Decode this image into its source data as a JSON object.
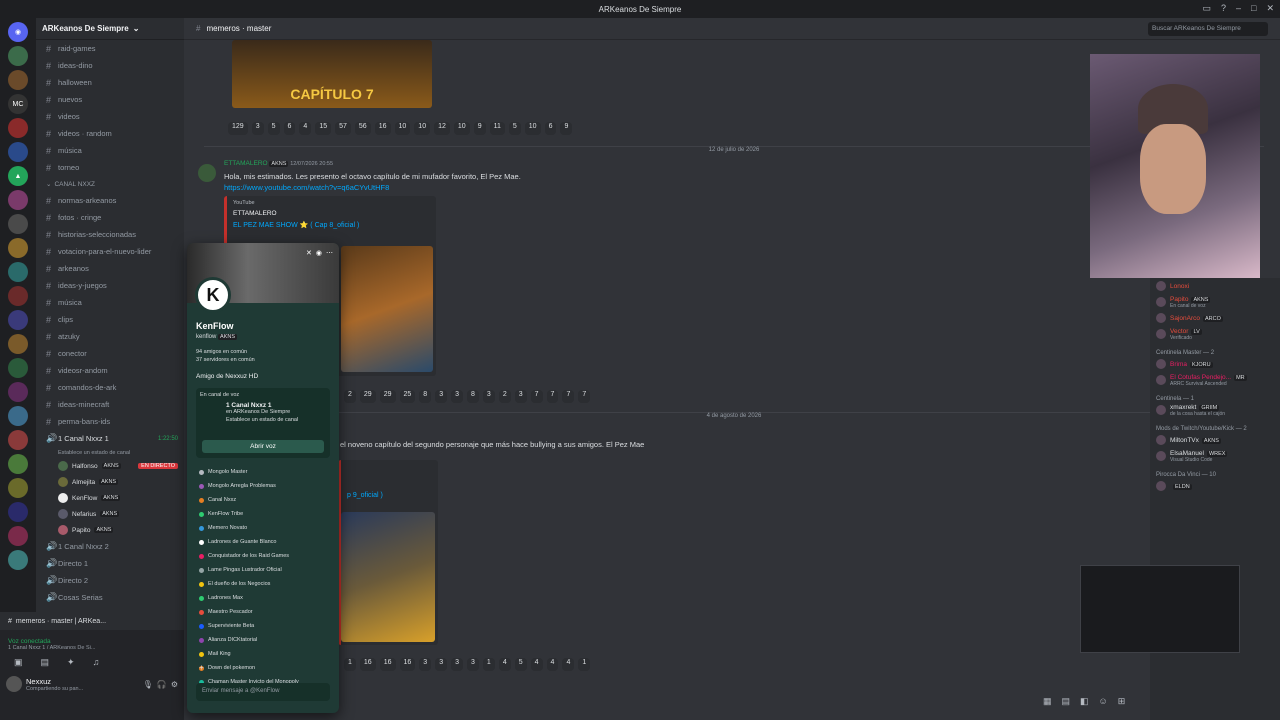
{
  "window": {
    "title": "ARKeanos De Siempre"
  },
  "server": {
    "name": "ARKeanos De Siempre"
  },
  "channels": [
    {
      "name": "raid-games"
    },
    {
      "name": "ideas-dino"
    },
    {
      "name": "halloween"
    },
    {
      "name": "nuevos"
    },
    {
      "name": "videos"
    },
    {
      "name": "videos · random"
    },
    {
      "name": "música"
    },
    {
      "name": "torneo"
    }
  ],
  "category1": "CANAL NXXZ",
  "channels2": [
    {
      "name": "normas-arkeanos"
    },
    {
      "name": "fotos · cringe"
    },
    {
      "name": "historias-seleccionadas"
    },
    {
      "name": "votacion-para-el-nuevo-lider"
    },
    {
      "name": "arkeanos"
    },
    {
      "name": "ideas-y-juegos"
    },
    {
      "name": "música"
    },
    {
      "name": "clips"
    },
    {
      "name": "atzuky"
    },
    {
      "name": "conector"
    },
    {
      "name": "videosr-andom"
    },
    {
      "name": "comandos-de-ark"
    },
    {
      "name": "ideas-minecraft"
    },
    {
      "name": "perma-bans-ids"
    }
  ],
  "voice_channel": {
    "name": "1 Canal Nxxz 1",
    "timer": "1:22:50",
    "status": "Establece un estado de canal"
  },
  "voice_users": [
    {
      "name": "Halfonso",
      "tag": "AKNS",
      "live": "EN DIRECTO"
    },
    {
      "name": "Almejita",
      "tag": "AKNS"
    },
    {
      "name": "KenFlow",
      "tag": "AKNS"
    },
    {
      "name": "Nefarius",
      "tag": "AKNS"
    },
    {
      "name": "Papito",
      "tag": "AKNS"
    }
  ],
  "voice_channels2": [
    {
      "name": "1 Canal Nxxz 2"
    },
    {
      "name": "Directo 1"
    },
    {
      "name": "Directo 2"
    },
    {
      "name": "Cosas Serias"
    }
  ],
  "userpanel": {
    "active_channel": "memeros · master | ARKea...",
    "voice_status": "Voz conectada",
    "voice_sub": "1 Canal Nxxz 1 / ARKeanos De Si...",
    "username": "Nexxuz",
    "user_status": "Compartiendo su pan..."
  },
  "topbar": {
    "channel": "memeros · master",
    "search_placeholder": "Buscar ARKeanos De Siempre"
  },
  "reactions_top": [
    "129",
    "3",
    "5",
    "6",
    "4",
    "15",
    "57",
    "56",
    "16",
    "10",
    "10",
    "12",
    "10",
    "9",
    "11",
    "5",
    "10",
    "6",
    "9"
  ],
  "date1": "12 de julio de 2026",
  "message1": {
    "author": "ETTAMALERO",
    "tag": "AKNS",
    "timestamp": "12/07/2026 20:55",
    "text": "Hola, mis estimados. Les presento el octavo capítulo de mi mufador favorito, El Pez Mae.",
    "link": "https://www.youtube.com/watch?v=q6aCYvUtHF8",
    "embed_provider": "YouTube",
    "embed_author": "ETTAMALERO",
    "embed_title": "EL PEZ MAE SHOW ⭐ ( Cap 8_oficial )"
  },
  "reactions_mid": [
    "2",
    "29",
    "29",
    "25",
    "8",
    "3",
    "3",
    "8",
    "3",
    "2",
    "3",
    "7",
    "7",
    "7",
    "7"
  ],
  "date2": "4 de agosto de 2026",
  "message2": {
    "text": "el noveno capítulo del segundo personaje que más hace bullying a sus amigos. El Pez Mae",
    "embed_title": "p 9_oficial )"
  },
  "reactions_bottom": [
    "1",
    "16",
    "16",
    "16",
    "3",
    "3",
    "3",
    "3",
    "1",
    "4",
    "5",
    "4",
    "4",
    "4",
    "1"
  ],
  "profile": {
    "name": "KenFlow",
    "username": "kenflow",
    "tag": "AKNS",
    "friends": "94 amigos en común",
    "servers": "37 servidores en común",
    "friend_of": "Amigo de Nexxuz HD",
    "voice_label": "En canal de voz",
    "voice_channel": "1 Canal Nxxz 1",
    "voice_server": "en ARKeanos De Siempre",
    "voice_status": "Establece un estado de canal",
    "join_button": "Abrir voz",
    "roles": [
      {
        "name": "Mongolo Master",
        "color": "#b5bac1"
      },
      {
        "name": "Mongolo Arregla Problemas",
        "color": "#9b59b6"
      },
      {
        "name": "Canal Nxxz",
        "color": "#e67e22"
      },
      {
        "name": "KenFlow Tribe",
        "color": "#2ecc71"
      },
      {
        "name": "Memero Novato",
        "color": "#3498db"
      },
      {
        "name": "Ladrones de Guante Blanco",
        "color": "#ffffff"
      },
      {
        "name": "Conquistador de los Raid Games",
        "color": "#e91e63"
      },
      {
        "name": "Lame Pingas Lustrador Oficial",
        "color": "#95a5a6"
      },
      {
        "name": "El dueño de los Negocios",
        "color": "#f1c40f"
      },
      {
        "name": "Ladrones Max",
        "color": "#2ecc71"
      },
      {
        "name": "Maestro Pescador",
        "color": "#e74c3c"
      },
      {
        "name": "Superviviente Beta",
        "color": "#1a5cff"
      },
      {
        "name": "Alianza DICKtatorial",
        "color": "#8e44ad"
      },
      {
        "name": "Mail King",
        "color": "#f1c40f"
      },
      {
        "name": "Down del pokemon",
        "color": "#e67e22"
      },
      {
        "name": "Chaman Master Invicto del Monopoly",
        "color": "#1abc9c"
      }
    ],
    "message_placeholder": "Enviar mensaje a @KenFlow"
  },
  "members": {
    "top_users": [
      {
        "name": "Lonoxi",
        "color": "#e74c3c"
      },
      {
        "name": "Papito",
        "tag": "AKNS",
        "sub": "En canal de voz",
        "color": "#e74c3c"
      },
      {
        "name": "SajonArco",
        "tag": "ARCO",
        "color": "#e74c3c"
      },
      {
        "name": "Vector",
        "tag": "LV",
        "sub": "Verificado",
        "color": "#e74c3c"
      }
    ],
    "groups": [
      {
        "label": "Centinela Master — 2",
        "users": [
          {
            "name": "Brima",
            "tag": "KJORU",
            "color": "#e91e63"
          },
          {
            "name": "El Cotufas Pendejo...",
            "tag": "MR",
            "sub": "ARRC Survival Ascended",
            "color": "#e91e63"
          }
        ]
      },
      {
        "label": "Centinela — 1",
        "users": [
          {
            "name": "xmaxrekt",
            "tag": "GRIIM",
            "sub": "de la cosa hasta el cajón",
            "color": "#dbdee1"
          }
        ]
      },
      {
        "label": "Mods de Twitch/Youtube/Kick — 2",
        "users": [
          {
            "name": "MiltonTVx",
            "tag": "AKNS",
            "color": "#dbdee1"
          },
          {
            "name": "ElsaManuel",
            "tag": "WREX",
            "sub": "Visual Studio Code",
            "color": "#dbdee1"
          }
        ]
      },
      {
        "label": "Pirocca Da Vinci — 10",
        "users": [
          {
            "name": "",
            "tag": "ELDN",
            "color": "#dbdee1"
          }
        ]
      }
    ]
  }
}
